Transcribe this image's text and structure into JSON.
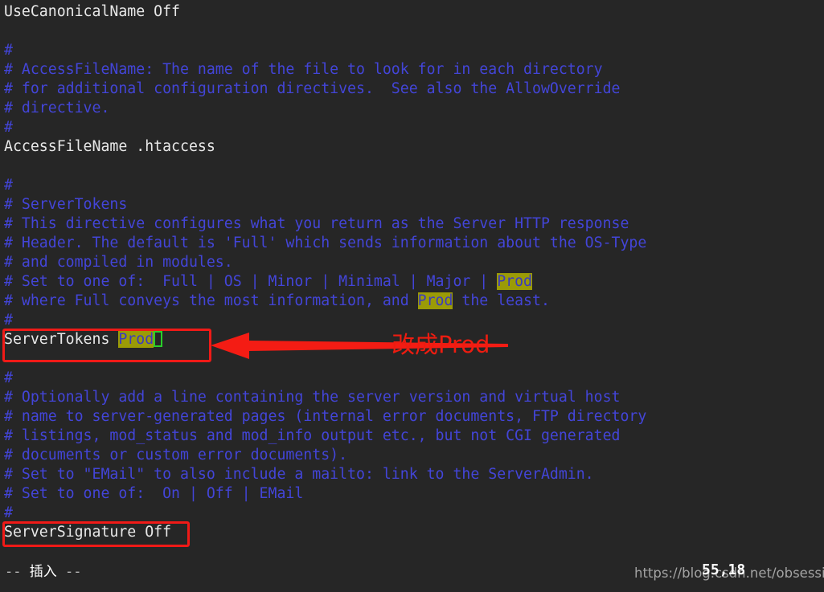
{
  "editor": {
    "type": "vim-terminal",
    "background_color": "#262626",
    "comment_color": "#4345d8",
    "text_color": "#e8e8e8",
    "highlight_bg_color": "#9b9b06",
    "cursor_border_color": "#2ad02a",
    "lines": [
      {
        "text": "UseCanonicalName Off",
        "kind": "normal"
      },
      {
        "text": "",
        "kind": "blank"
      },
      {
        "text": "#",
        "kind": "comment"
      },
      {
        "text": "# AccessFileName: The name of the file to look for in each directory",
        "kind": "comment"
      },
      {
        "text": "# for additional configuration directives.  See also the AllowOverride",
        "kind": "comment"
      },
      {
        "text": "# directive.",
        "kind": "comment"
      },
      {
        "text": "#",
        "kind": "comment"
      },
      {
        "text": "AccessFileName .htaccess",
        "kind": "normal"
      },
      {
        "text": "",
        "kind": "blank"
      },
      {
        "text": "#",
        "kind": "comment"
      },
      {
        "text": "# ServerTokens",
        "kind": "comment"
      },
      {
        "text": "# This directive configures what you return as the Server HTTP response",
        "kind": "comment"
      },
      {
        "text": "# Header. The default is 'Full' which sends information about the OS-Type",
        "kind": "comment"
      },
      {
        "text": "# and compiled in modules.",
        "kind": "comment"
      },
      {
        "text": "# Set to one of:  Full | OS | Minor | Minimal | Major | Prod",
        "kind": "comment-hl",
        "highlight": "Prod"
      },
      {
        "text": "# where Full conveys the most information, and Prod the least.",
        "kind": "comment-hl",
        "highlight": "Prod"
      },
      {
        "text": "#",
        "kind": "comment"
      },
      {
        "text": "ServerTokens Prod",
        "kind": "directive-cursor",
        "prefix": "ServerTokens ",
        "highlight": "Prod"
      },
      {
        "text": "",
        "kind": "blank"
      },
      {
        "text": "#",
        "kind": "comment"
      },
      {
        "text": "# Optionally add a line containing the server version and virtual host",
        "kind": "comment"
      },
      {
        "text": "# name to server-generated pages (internal error documents, FTP directory",
        "kind": "comment"
      },
      {
        "text": "# listings, mod_status and mod_info output etc., but not CGI generated",
        "kind": "comment"
      },
      {
        "text": "# documents or custom error documents).",
        "kind": "comment"
      },
      {
        "text": "# Set to \"EMail\" to also include a mailto: link to the ServerAdmin.",
        "kind": "comment"
      },
      {
        "text": "# Set to one of:  On | Off | EMail",
        "kind": "comment"
      },
      {
        "text": "#",
        "kind": "comment"
      },
      {
        "text": "ServerSignature Off",
        "kind": "normal"
      }
    ]
  },
  "annotations": {
    "color": "#ee1c10",
    "note_text": "改成Prod",
    "boxed_line_1": "ServerTokens Prod",
    "boxed_line_2": "ServerSignature Off",
    "arrow": "left-arrow"
  },
  "statusline": {
    "dash_left": "-- ",
    "mode": "插入",
    "dash_right": " --",
    "full": "-- 插入 --",
    "position": "55,18"
  },
  "watermark": {
    "text": "https://blog.csdn.net/obsessiveY"
  }
}
